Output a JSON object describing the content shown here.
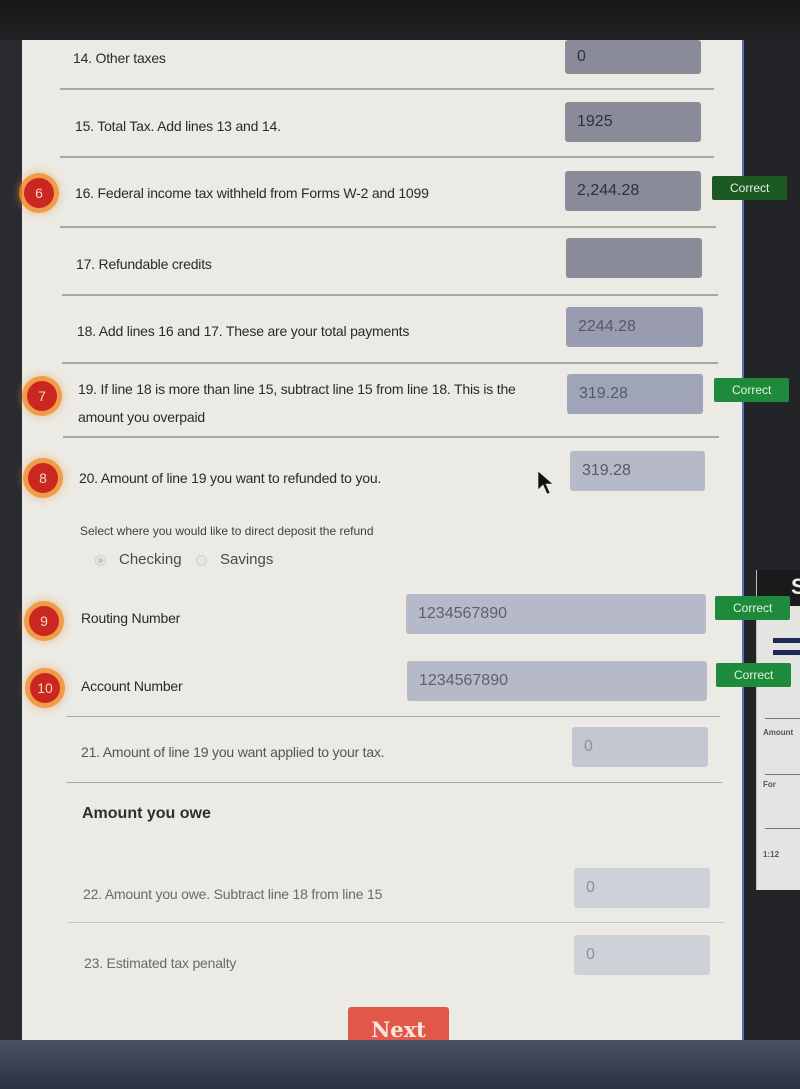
{
  "form": {
    "lines": [
      {
        "number": "14",
        "label": "14. Other taxes",
        "value": "0"
      },
      {
        "number": "15",
        "label": "15. Total Tax. Add lines 13 and 14.",
        "value": "1925"
      },
      {
        "number": "16",
        "label": "16. Federal income tax withheld from Forms W-2 and 1099",
        "value": "2,244.28",
        "step": "6",
        "status": "Correct"
      },
      {
        "number": "17",
        "label": "17. Refundable credits",
        "value": ""
      },
      {
        "number": "18",
        "label": "18. Add lines 16 and 17. These are your total payments",
        "value": "2244.28"
      },
      {
        "number": "19",
        "label_line1": "19. If line 18 is more than line 15, subtract line 15 from line 18. This is the",
        "label_line2": "amount you overpaid",
        "value": "319.28",
        "step": "7",
        "status": "Correct"
      },
      {
        "number": "20",
        "label": "20. Amount of line 19 you want to refunded to you.",
        "value": "319.28",
        "step": "8"
      }
    ],
    "deposit": {
      "question": "Select where you would like to direct deposit the refund",
      "options": [
        "Checking",
        "Savings"
      ],
      "selected": "Checking"
    },
    "routing": {
      "label": "Routing Number",
      "value": "1234567890",
      "step": "9",
      "status": "Correct"
    },
    "account": {
      "label": "Account Number",
      "value": "1234567890",
      "step": "10",
      "status": "Correct"
    },
    "line21": {
      "label": "21. Amount of line 19 you want applied to your tax.",
      "value": "0"
    },
    "owe_heading": "Amount you owe",
    "line22": {
      "label": "22. Amount you owe. Subtract line 18 from line 15",
      "value": "0"
    },
    "line23": {
      "label": "23. Estimated tax penalty",
      "value": "0"
    },
    "next_label": "Next"
  },
  "background_window": {
    "glyph": "S",
    "texts": [
      "Amount",
      "For",
      "1:12"
    ]
  },
  "colors": {
    "badge": "#c9271f",
    "correct": "#1e8b3c",
    "next": "#e1584a",
    "page_bg": "#ebeae4"
  }
}
